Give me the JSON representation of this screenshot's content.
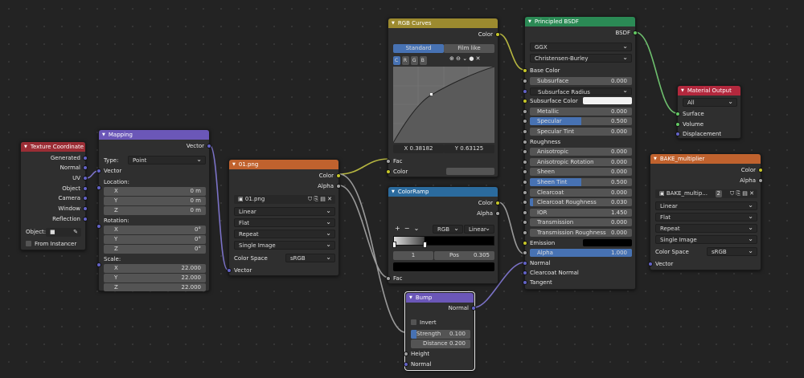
{
  "colors": {
    "input": "#9b2d35",
    "vector": "#6b57b8",
    "texture": "#c0622e",
    "color": "#9c8a2f",
    "converter": "#2b6b9e",
    "shader": "#2b8a55",
    "output": "#b3283d"
  },
  "texcoord": {
    "title": "Texture Coordinate",
    "outputs": [
      "Generated",
      "Normal",
      "UV",
      "Object",
      "Camera",
      "Window",
      "Reflection"
    ],
    "object_label": "Object:",
    "from_instancer": "From Instancer"
  },
  "mapping": {
    "title": "Mapping",
    "out": "Vector",
    "type_label": "Type:",
    "type_value": "Point",
    "vector_in": "Vector",
    "location": "Location:",
    "rotation": "Rotation:",
    "scale": "Scale:",
    "loc": [
      {
        "axis": "X",
        "val": "0 m"
      },
      {
        "axis": "Y",
        "val": "0 m"
      },
      {
        "axis": "Z",
        "val": "0 m"
      }
    ],
    "rot": [
      {
        "axis": "X",
        "val": "0°"
      },
      {
        "axis": "Y",
        "val": "0°"
      },
      {
        "axis": "Z",
        "val": "0°"
      }
    ],
    "scl": [
      {
        "axis": "X",
        "val": "22.000"
      },
      {
        "axis": "Y",
        "val": "22.000"
      },
      {
        "axis": "Z",
        "val": "22.000"
      }
    ]
  },
  "image": {
    "title": "01.png",
    "out_color": "Color",
    "out_alpha": "Alpha",
    "file": "01.png",
    "interp": "Linear",
    "proj": "Flat",
    "ext": "Repeat",
    "src": "Single Image",
    "cs_label": "Color Space",
    "cs_value": "sRGB",
    "vector_in": "Vector"
  },
  "curves": {
    "title": "RGB Curves",
    "out": "Color",
    "tab_standard": "Standard",
    "tab_film": "Film like",
    "chan": [
      "C",
      "R",
      "G",
      "B"
    ],
    "x_readout": "X 0.38182",
    "y_readout": "Y 0.63125",
    "fac": "Fac",
    "color_in": "Color"
  },
  "ramp": {
    "title": "ColorRamp",
    "out_color": "Color",
    "out_alpha": "Alpha",
    "mode": "RGB",
    "interp": "Linear",
    "index": "1",
    "pos_label": "Pos",
    "pos_value": "0.305",
    "fac": "Fac"
  },
  "bump": {
    "title": "Bump",
    "out": "Normal",
    "invert": "Invert",
    "strength_label": "Strength",
    "strength_value": "0.100",
    "distance_label": "Distance",
    "distance_value": "0.200",
    "height": "Height",
    "normal": "Normal",
    "strength_fraction": 0.1
  },
  "bsdf": {
    "title": "Principled BSDF",
    "out": "BSDF",
    "dist": "GGX",
    "sss_method": "Christensen-Burley",
    "base_color": "Base Color",
    "inputs": [
      {
        "label": "Subsurface",
        "value": "0.000",
        "frac": 0
      },
      {
        "label": "Subsurface Radius",
        "value": "",
        "frac": 0,
        "dd": true
      },
      {
        "label": "Subsurface Color",
        "value": "",
        "frac": 0,
        "swatch": "#f2f2f2"
      },
      {
        "label": "Metallic",
        "value": "0.000",
        "frac": 0
      },
      {
        "label": "Specular",
        "value": "0.500",
        "frac": 0.5
      },
      {
        "label": "Specular Tint",
        "value": "0.000",
        "frac": 0
      },
      {
        "label": "Roughness",
        "value": "",
        "frac": 0,
        "plain": true
      },
      {
        "label": "Anisotropic",
        "value": "0.000",
        "frac": 0
      },
      {
        "label": "Anisotropic Rotation",
        "value": "0.000",
        "frac": 0
      },
      {
        "label": "Sheen",
        "value": "0.000",
        "frac": 0
      },
      {
        "label": "Sheen Tint",
        "value": "0.500",
        "frac": 0.5
      },
      {
        "label": "Clearcoat",
        "value": "0.000",
        "frac": 0
      },
      {
        "label": "Clearcoat Roughness",
        "value": "0.030",
        "frac": 0.03
      },
      {
        "label": "IOR",
        "value": "1.450",
        "frac": 0
      },
      {
        "label": "Transmission",
        "value": "0.000",
        "frac": 0
      },
      {
        "label": "Transmission Roughness",
        "value": "0.000",
        "frac": 0
      },
      {
        "label": "Emission",
        "value": "",
        "frac": 0,
        "swatch": "#000000"
      },
      {
        "label": "Alpha",
        "value": "1.000",
        "frac": 1
      }
    ],
    "tail": [
      "Normal",
      "Clearcoat Normal",
      "Tangent"
    ]
  },
  "output": {
    "title": "Material Output",
    "target": "All",
    "inputs": [
      "Surface",
      "Volume",
      "Displacement"
    ]
  },
  "bake": {
    "title": "BAKE_multiplier",
    "out_color": "Color",
    "out_alpha": "Alpha",
    "file": "BAKE_multip...",
    "users": "2",
    "interp": "Linear",
    "proj": "Flat",
    "ext": "Repeat",
    "src": "Single Image",
    "cs_label": "Color Space",
    "cs_value": "sRGB",
    "vector_in": "Vector"
  }
}
